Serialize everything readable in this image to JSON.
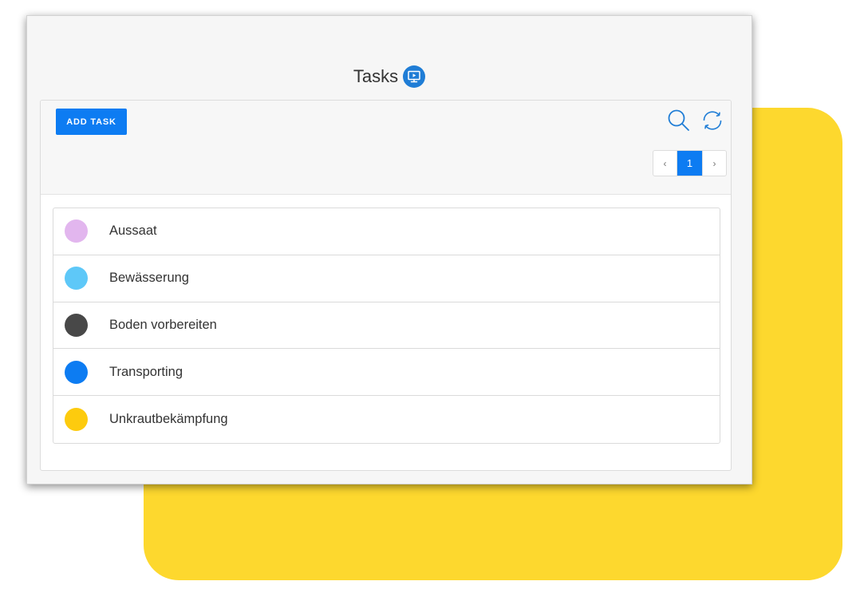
{
  "page": {
    "title": "Tasks"
  },
  "toolbar": {
    "add_label": "ADD TASK"
  },
  "pagination": {
    "prev": "‹",
    "current": "1",
    "next": "›"
  },
  "icons": {
    "title": "monitor-play-icon",
    "search": "search-icon",
    "refresh": "refresh-icon"
  },
  "colors": {
    "accent": "#0d7cf2",
    "background_card": "#fdd82e"
  },
  "tasks": [
    {
      "label": "Aussaat",
      "color": "#e2b6ee"
    },
    {
      "label": "Bewässerung",
      "color": "#5ec8f8"
    },
    {
      "label": "Boden vorbereiten",
      "color": "#484848"
    },
    {
      "label": "Transporting",
      "color": "#0d7cf2"
    },
    {
      "label": "Unkrautbekämpfung",
      "color": "#fdcb0e"
    }
  ]
}
